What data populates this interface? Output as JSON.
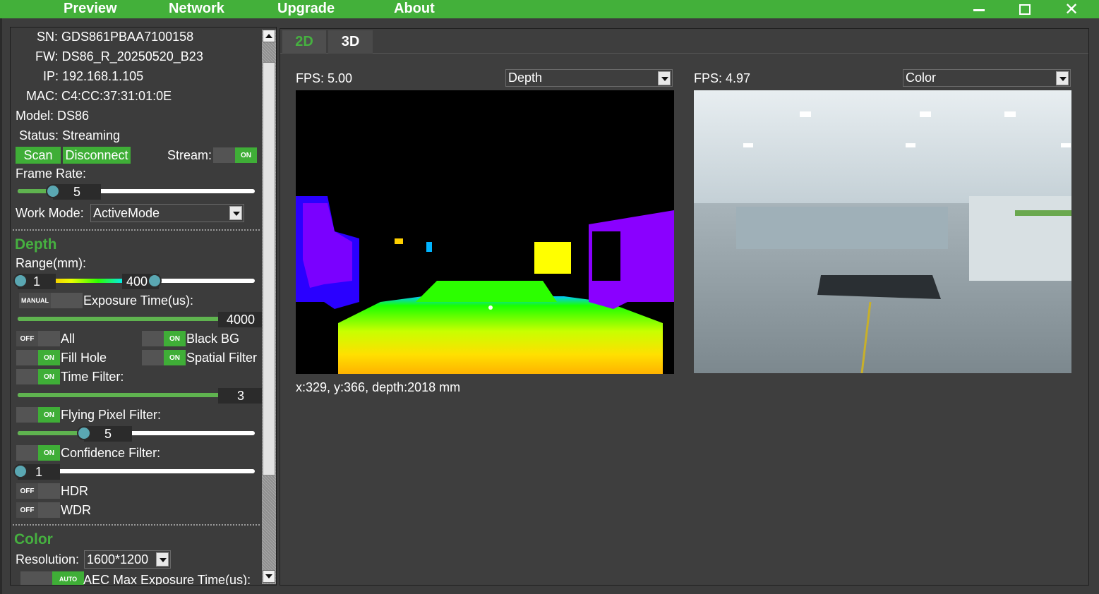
{
  "menu": {
    "preview": "Preview",
    "network": "Network",
    "upgrade": "Upgrade",
    "about": "About"
  },
  "window_controls": {
    "close_glyph": "✕"
  },
  "device": {
    "sn": "SN: GDS861PBAA7100158",
    "fw": "FW: DS86_R_20250520_B23",
    "ip": "IP: 192.168.1.105",
    "mac": "MAC: C4:CC:37:31:01:0E",
    "model": "Model: DS86",
    "status": "Status: Streaming"
  },
  "controls": {
    "scan_label": "Scan",
    "disconnect_label": "Disconnect",
    "stream_label": "Stream:",
    "stream_toggle": "ON",
    "frame_rate_label": "Frame Rate:",
    "frame_rate_value": "5",
    "frame_rate_fraction": 0.14,
    "work_mode_label": "Work Mode:",
    "work_mode_value": "ActiveMode"
  },
  "depth": {
    "title": "Depth",
    "range_label": "Range(mm):",
    "range_min": "1",
    "range_max": "4000",
    "exposure_mode": "MANUAL",
    "exposure_label": "Exposure Time(us):",
    "exposure_value": "4000",
    "toggles": {
      "all": {
        "state": "OFF",
        "label": "All"
      },
      "black_bg": {
        "state": "ON",
        "label": "Black BG"
      },
      "fill_hole": {
        "state": "ON",
        "label": "Fill Hole"
      },
      "spatial_filter": {
        "state": "ON",
        "label": "Spatial Filter"
      },
      "time_filter": {
        "state": "ON",
        "label": "Time Filter:"
      },
      "flying_pixel": {
        "state": "ON",
        "label": "Flying Pixel Filter:"
      },
      "confidence": {
        "state": "ON",
        "label": "Confidence Filter:"
      },
      "hdr": {
        "state": "OFF",
        "label": "HDR"
      },
      "wdr": {
        "state": "OFF",
        "label": "WDR"
      }
    },
    "time_filter_value": "3",
    "flying_pixel_value": "5",
    "confidence_value": "1"
  },
  "color": {
    "title": "Color",
    "resolution_label": "Resolution:",
    "resolution_value": "1600*1200",
    "aec_mode": "AUTO",
    "aec_label": "AEC Max Exposure Time(us):"
  },
  "tabs": {
    "tab_2d": "2D",
    "tab_3d": "3D"
  },
  "views": {
    "depth_fps": "FPS: 5.00",
    "depth_select": "Depth",
    "color_fps": "FPS: 4.97",
    "color_select": "Color",
    "pixel_readout": "x:329, y:366, depth:2018 mm"
  },
  "colors": {
    "accent": "#43b03a",
    "background": "#3c3c3c"
  }
}
